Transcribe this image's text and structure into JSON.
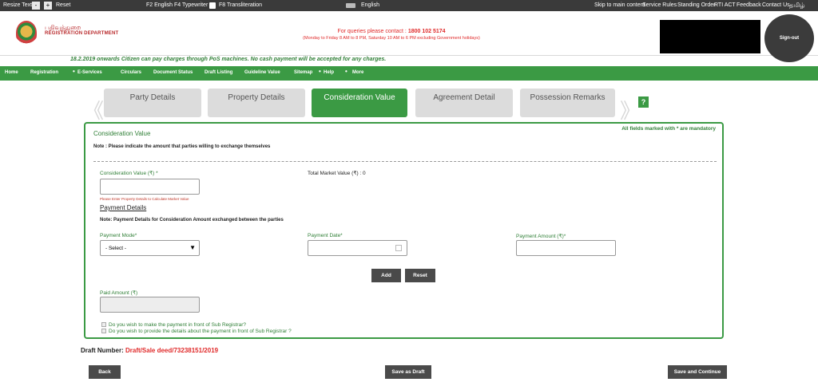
{
  "topbar": {
    "resize_text": "Resize Text",
    "minus": "-",
    "plus": "+",
    "reset": "Reset",
    "f2": "F2 English",
    "f4": "F4 Typewriter",
    "f8": "F8 Transliteration",
    "english": "English",
    "links": [
      "Skip to main content",
      "Service Rules",
      "Standing Order",
      "RTI ACT",
      "Feedback",
      "Contact Us",
      "தமிழ்"
    ]
  },
  "header": {
    "logo_tamil": "பதிவுத்துறை",
    "logo_english": "REGISTRATION DEPARTMENT",
    "query_text": "For queries please contact :",
    "query_number": "1800 102 5174",
    "query_hours": "(Monday to Friday 8 AM to 8 PM, Saturday 10 AM to 6 PM excluding Government holidays)",
    "signout": "Sign-out"
  },
  "notice": "18.2.2019 onwards Citizen can pay charges through PoS machines. No cash payment will be accepted for any charges.",
  "nav": [
    "Home",
    "Registration",
    "E-Services",
    "Circulars",
    "Document Status",
    "Draft Listing",
    "Guideline Value",
    "Sitemap",
    "Help",
    "More"
  ],
  "tabs": [
    "Party Details",
    "Property Details",
    "Consideration Value",
    "Agreement Detail",
    "Possession Remarks"
  ],
  "help": "?",
  "form": {
    "title": "Consideration Value",
    "mandatory": "All fields marked with * are mandatory",
    "note": "Note : Please indicate the amount that parties willing to exchange themselves",
    "consideration_label": "Consideration Value (₹) *",
    "total_market": "Total Market Value (₹) : 0",
    "consideration_hint": "Please Enter Property Details to Calculate Market Value",
    "payment_heading": "Payment Details",
    "payment_note": "Note: Payment Details for Consideration Amount exchanged between the parties",
    "payment_mode_label": "Payment Mode*",
    "payment_mode_value": "- Select -",
    "payment_date_label": "Payment Date*",
    "payment_amount_label": "Payment Amount (₹)*",
    "add": "Add",
    "reset": "Reset",
    "paid_amount_label": "Paid Amount (₹)",
    "check1": "Do you wish to make the payment in front of Sub Registrar?",
    "check2": "Do you wish to provide the details about the payment in front of Sub Registrar ?"
  },
  "draft": {
    "label": "Draft Number:",
    "value": "Draft/Sale deed/73238151/2019"
  },
  "footer": {
    "back": "Back",
    "save_draft": "Save as Draft",
    "save_continue": "Save and Continue"
  },
  "colors": {
    "green": "#3b9a44",
    "dark": "#3a3a3a",
    "red": "#e02a2a"
  }
}
